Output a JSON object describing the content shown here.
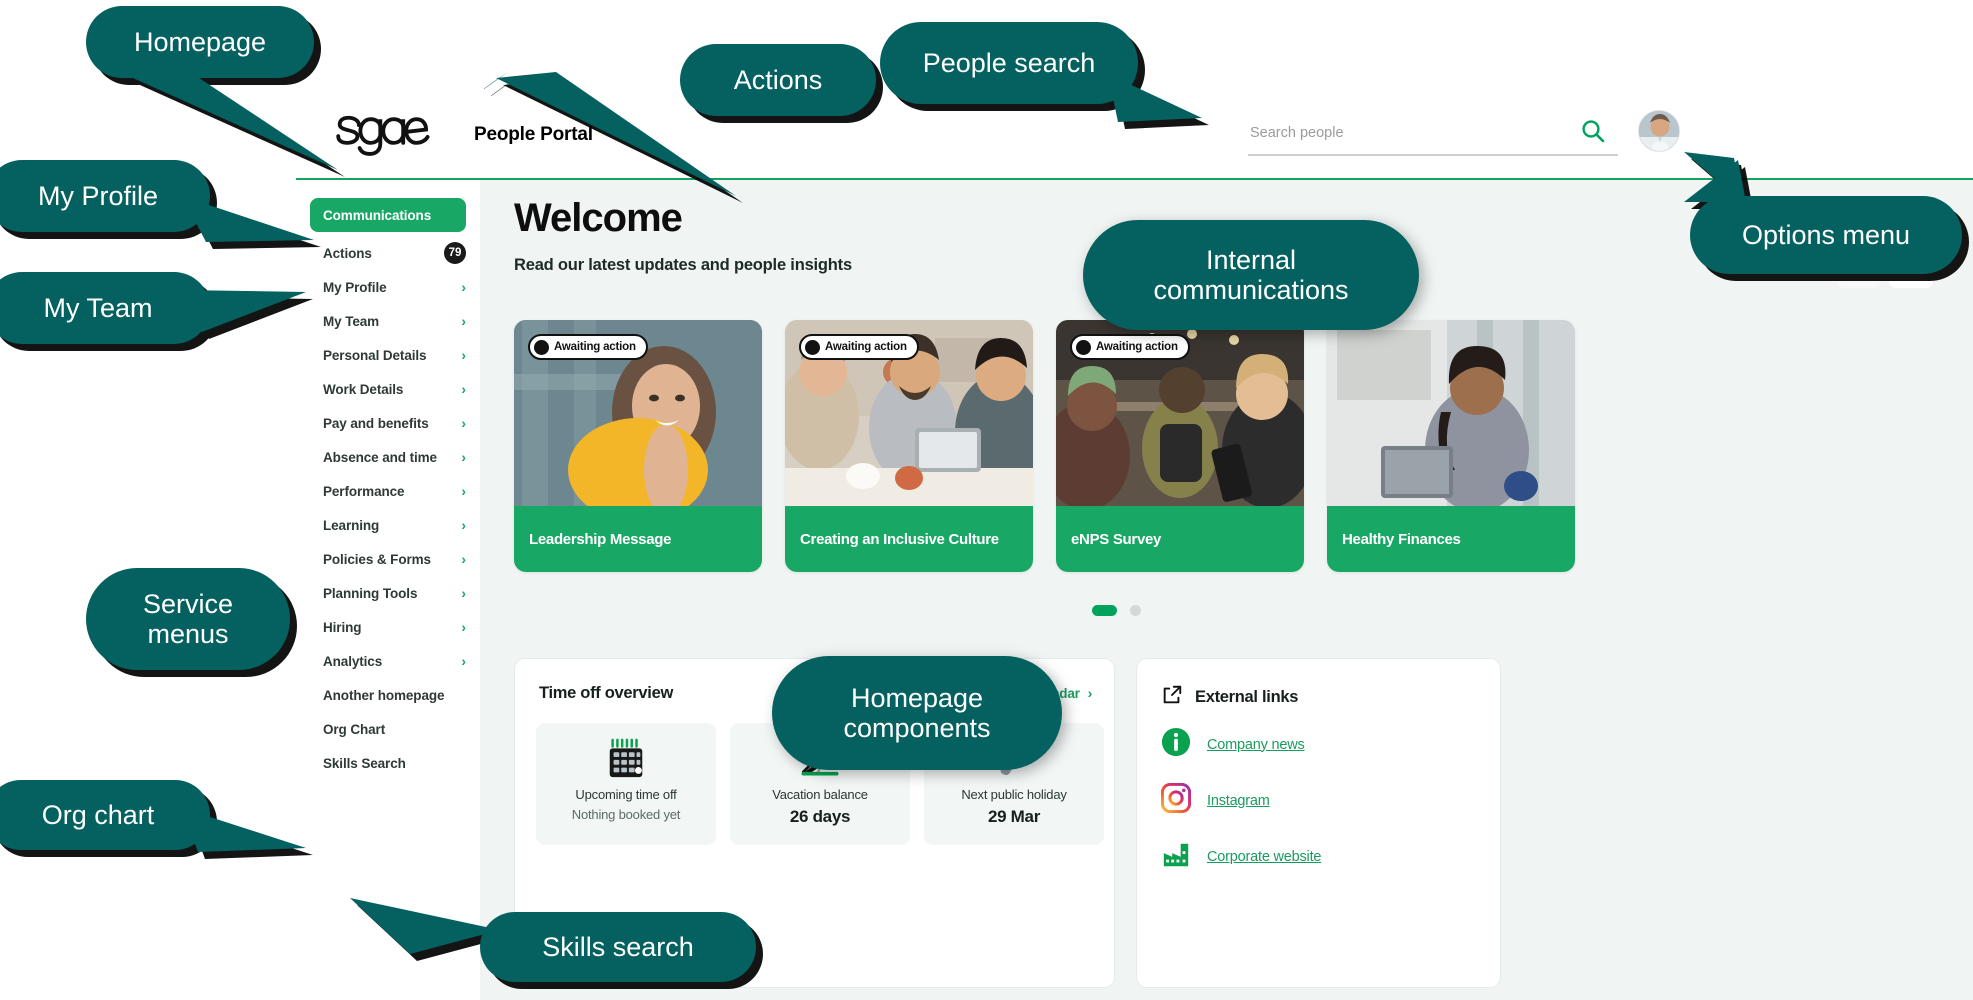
{
  "app": {
    "brand": "Sage",
    "title": "People Portal",
    "search": {
      "placeholder": "Search people",
      "value": ""
    },
    "page_title": "Welcome",
    "page_subtitle": "Read our latest updates and people insights"
  },
  "sidebar": {
    "active": {
      "label": "Communications"
    },
    "items": [
      {
        "label": "Actions",
        "badge": "79",
        "chevron": false
      },
      {
        "label": "My Profile",
        "chevron": true
      },
      {
        "label": "My Team",
        "chevron": true
      },
      {
        "label": "Personal Details",
        "chevron": true
      },
      {
        "label": "Work Details",
        "chevron": true
      },
      {
        "label": "Pay and benefits",
        "chevron": true
      },
      {
        "label": "Absence and time",
        "chevron": true
      },
      {
        "label": "Performance",
        "chevron": true
      },
      {
        "label": "Learning",
        "chevron": true
      },
      {
        "label": "Policies & Forms",
        "chevron": true
      },
      {
        "label": "Planning Tools",
        "chevron": true
      },
      {
        "label": "Hiring",
        "chevron": true
      },
      {
        "label": "Analytics",
        "chevron": true
      },
      {
        "label": "Another homepage",
        "chevron": false
      },
      {
        "label": "Org Chart",
        "chevron": false
      },
      {
        "label": "Skills Search",
        "chevron": false
      }
    ]
  },
  "carousel": {
    "prev_icon": "arrow-left-icon",
    "next_icon": "arrow-right-icon",
    "cards": [
      {
        "status": "Awaiting action",
        "title": "Leadership Message"
      },
      {
        "status": "Awaiting action",
        "title": "Creating an Inclusive Culture"
      },
      {
        "status": "Awaiting action",
        "title": "eNPS Survey"
      },
      {
        "status": "",
        "title": "Healthy Finances"
      }
    ],
    "dots": [
      {
        "active": true
      },
      {
        "active": false
      }
    ]
  },
  "time_off": {
    "heading": "Time off overview",
    "link": "View your absence calendar",
    "tiles": [
      {
        "icon": "calendar-icon",
        "label": "Upcoming time off",
        "sub": "Nothing booked yet",
        "value": ""
      },
      {
        "icon": "beach-chair-icon",
        "label": "Vacation balance",
        "value": "26 days",
        "sub": ""
      },
      {
        "icon": "megaphone-icon",
        "label": "Next public holiday",
        "value": "29 Mar",
        "sub": ""
      }
    ]
  },
  "external_links": {
    "heading": "External links",
    "heading_icon": "external-link-icon",
    "links": [
      {
        "icon": "info-circle-icon",
        "label": "Company news"
      },
      {
        "icon": "instagram-icon",
        "label": "Instagram"
      },
      {
        "icon": "factory-icon",
        "label": "Corporate website"
      }
    ]
  },
  "annotations": {
    "accent_color": "#046160",
    "callouts": [
      {
        "id": "homepage",
        "text": "Homepage"
      },
      {
        "id": "my-profile",
        "text": "My Profile"
      },
      {
        "id": "my-team",
        "text": "My Team"
      },
      {
        "id": "service-menus",
        "text": "Service menus"
      },
      {
        "id": "org-chart",
        "text": "Org chart"
      },
      {
        "id": "actions",
        "text": "Actions"
      },
      {
        "id": "people-search",
        "text": "People search"
      },
      {
        "id": "internal-communications",
        "text": "Internal communications"
      },
      {
        "id": "options-menu",
        "text": "Options menu"
      },
      {
        "id": "homepage-components",
        "text": "Homepage components"
      },
      {
        "id": "skills-search",
        "text": "Skills search"
      }
    ]
  },
  "colors": {
    "brand_green": "#19a765",
    "accent_teal": "#046160",
    "canvas": "#f0f4f3",
    "link_green": "#1a9c5d"
  }
}
